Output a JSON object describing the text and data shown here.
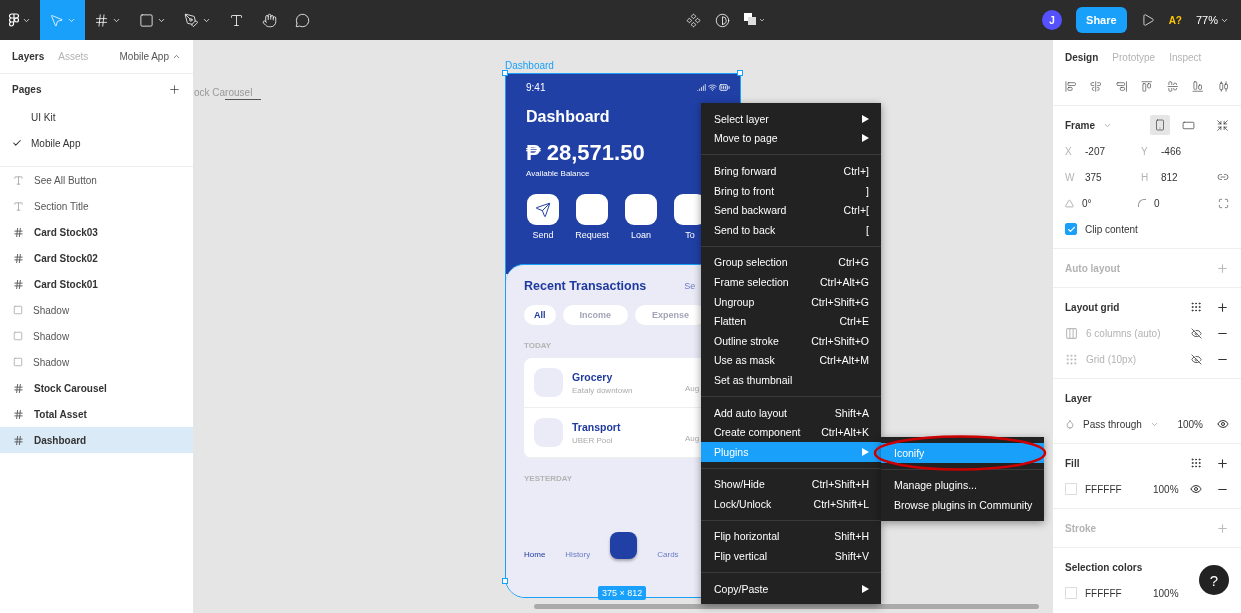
{
  "toolbar": {
    "tools": [
      {
        "kind": "logo",
        "selected": false
      },
      {
        "kind": "move",
        "selected": true
      },
      {
        "kind": "frame",
        "selected": false
      },
      {
        "kind": "shape",
        "selected": false
      },
      {
        "kind": "pen",
        "selected": false
      },
      {
        "kind": "text",
        "selected": false
      },
      {
        "kind": "hand",
        "selected": false
      },
      {
        "kind": "comment",
        "selected": false
      }
    ],
    "avatar": "J",
    "share": "Share",
    "font_warning": "A?",
    "zoom": "77%"
  },
  "left_panel": {
    "tabs": [
      {
        "label": "Layers",
        "selected": true
      },
      {
        "label": "Assets",
        "selected": false
      }
    ],
    "page_switcher": "Mobile App",
    "pages_title": "Pages",
    "pages": [
      {
        "label": "UI Kit",
        "selected": false
      },
      {
        "label": "Mobile App",
        "selected": true
      }
    ],
    "layers": [
      {
        "label": "See All Button",
        "kind": "text",
        "selected": false
      },
      {
        "label": "Section Title",
        "kind": "text",
        "selected": false
      },
      {
        "label": "Card Stock03",
        "kind": "frame",
        "selected": false
      },
      {
        "label": "Card Stock02",
        "kind": "frame",
        "selected": false
      },
      {
        "label": "Card Stock01",
        "kind": "frame",
        "selected": false
      },
      {
        "label": "Shadow",
        "kind": "rectangle",
        "selected": false
      },
      {
        "label": "Shadow",
        "kind": "rectangle",
        "selected": false
      },
      {
        "label": "Shadow",
        "kind": "rectangle",
        "selected": false
      },
      {
        "label": "Stock Carousel",
        "kind": "frame",
        "selected": false
      },
      {
        "label": "Total Asset",
        "kind": "frame",
        "selected": false
      },
      {
        "label": "Dashboard",
        "kind": "frame",
        "selected": true
      }
    ]
  },
  "canvas": {
    "side_label": "ock Carousel",
    "frame_label": "Dashboard",
    "size_badge": "375 × 812",
    "phone": {
      "time": "9:41",
      "title": "Dashboard",
      "balance": "₱ 28,571.50",
      "balance_label": "Available Balance",
      "actions": [
        {
          "label": "Send",
          "has_icon": true
        },
        {
          "label": "Request",
          "has_icon": false
        },
        {
          "label": "Loan",
          "has_icon": false
        },
        {
          "label": "To",
          "has_icon": false
        }
      ],
      "section_title": "Recent Transactions",
      "see_all": "Se",
      "filters": [
        {
          "label": "All",
          "selected": true
        },
        {
          "label": "Income",
          "selected": false
        },
        {
          "label": "Expense",
          "selected": false
        }
      ],
      "today": "TODAY",
      "transactions": [
        {
          "name": "Grocery",
          "detail": "Eataly downtown",
          "date": "Aug"
        },
        {
          "name": "Transport",
          "detail": "UBER Pool",
          "date": "Aug"
        }
      ],
      "yesterday": "YESTERDAY",
      "nav": [
        {
          "label": "Home",
          "selected": true
        },
        {
          "label": "History",
          "selected": false
        },
        {
          "label": "Cards",
          "selected": false
        }
      ]
    },
    "context_menu": [
      [
        {
          "label": "Select layer",
          "submenu": true,
          "highlighted": false
        },
        {
          "label": "Move to page",
          "submenu": true,
          "highlighted": false
        }
      ],
      [
        {
          "label": "Bring forward",
          "shortcut": "Ctrl+]",
          "highlighted": false
        },
        {
          "label": "Bring to front",
          "shortcut": "]",
          "highlighted": false
        },
        {
          "label": "Send backward",
          "shortcut": "Ctrl+[",
          "highlighted": false
        },
        {
          "label": "Send to back",
          "shortcut": "[",
          "highlighted": false
        }
      ],
      [
        {
          "label": "Group selection",
          "shortcut": "Ctrl+G",
          "highlighted": false
        },
        {
          "label": "Frame selection",
          "shortcut": "Ctrl+Alt+G",
          "highlighted": false
        },
        {
          "label": "Ungroup",
          "shortcut": "Ctrl+Shift+G",
          "highlighted": false
        },
        {
          "label": "Flatten",
          "shortcut": "Ctrl+E",
          "highlighted": false
        },
        {
          "label": "Outline stroke",
          "shortcut": "Ctrl+Shift+O",
          "highlighted": false
        },
        {
          "label": "Use as mask",
          "shortcut": "Ctrl+Alt+M",
          "highlighted": false
        },
        {
          "label": "Set as thumbnail",
          "highlighted": false
        }
      ],
      [
        {
          "label": "Add auto layout",
          "shortcut": "Shift+A",
          "highlighted": false
        },
        {
          "label": "Create component",
          "shortcut": "Ctrl+Alt+K",
          "highlighted": false
        },
        {
          "label": "Plugins",
          "submenu": true,
          "highlighted": true
        }
      ],
      [
        {
          "label": "Show/Hide",
          "shortcut": "Ctrl+Shift+H",
          "highlighted": false
        },
        {
          "label": "Lock/Unlock",
          "shortcut": "Ctrl+Shift+L",
          "highlighted": false
        }
      ],
      [
        {
          "label": "Flip horizontal",
          "shortcut": "Shift+H",
          "highlighted": false
        },
        {
          "label": "Flip vertical",
          "shortcut": "Shift+V",
          "highlighted": false
        }
      ],
      [
        {
          "label": "Copy/Paste",
          "submenu": true,
          "highlighted": false
        }
      ]
    ],
    "submenu": [
      [
        {
          "label": "Iconify",
          "highlighted": true,
          "circled": true
        }
      ],
      [
        {
          "label": "Manage plugins...",
          "highlighted": false,
          "circled": false
        },
        {
          "label": "Browse plugins in Community",
          "highlighted": false,
          "circled": false
        }
      ]
    ]
  },
  "right_panel": {
    "tabs": [
      {
        "label": "Design",
        "selected": true
      },
      {
        "label": "Prototype",
        "selected": false
      },
      {
        "label": "Inspect",
        "selected": false
      }
    ],
    "frame": {
      "title": "Frame",
      "orientation": [
        {
          "kind": "portrait",
          "selected": true
        },
        {
          "kind": "landscape",
          "selected": false
        }
      ],
      "fields": [
        {
          "label": "X",
          "value": "-207"
        },
        {
          "label": "Y",
          "value": "-466"
        },
        {
          "label": "W",
          "value": "375"
        },
        {
          "label": "H",
          "value": "812"
        }
      ],
      "rotation": "0°",
      "radius": "0",
      "clip_content": {
        "label": "Clip content",
        "checked": true
      }
    },
    "auto_layout": "Auto layout",
    "layout_grid": {
      "title": "Layout grid",
      "grids": [
        {
          "kind": "columns",
          "label": "6 columns (auto)"
        },
        {
          "kind": "grid",
          "label": "Grid (10px)"
        }
      ]
    },
    "layer": {
      "title": "Layer",
      "blend": "Pass through",
      "opacity": "100%"
    },
    "fill": {
      "title": "Fill",
      "hex": "FFFFFF",
      "opacity": "100%"
    },
    "stroke": "Stroke",
    "selection_colors": {
      "title": "Selection colors",
      "hex": "FFFFFF",
      "opacity": "100%"
    },
    "help": "?"
  }
}
